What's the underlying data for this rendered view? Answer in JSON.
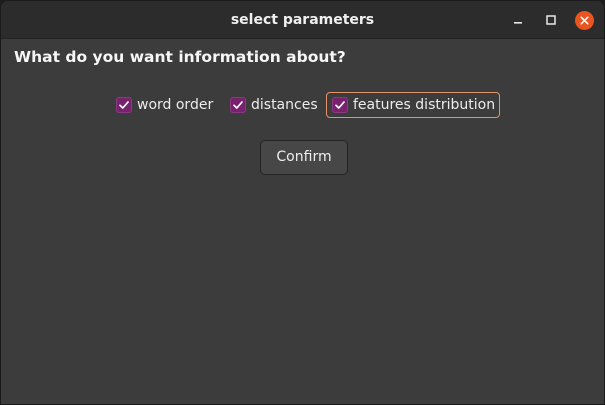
{
  "window": {
    "title": "select parameters"
  },
  "main": {
    "heading": "What do you want information about?",
    "options": [
      {
        "label": "word order",
        "checked": true
      },
      {
        "label": "distances",
        "checked": true
      },
      {
        "label": "features distribution",
        "checked": true,
        "focused": true
      }
    ],
    "confirm_label": "Confirm"
  },
  "colors": {
    "accent": "#77216f",
    "close_button": "#e95420",
    "focus_ring": "#e3926c",
    "window_bg": "#3c3c3c",
    "titlebar_bg": "#2c2c2c"
  },
  "icons": {
    "minimize": "minimize-icon",
    "maximize": "maximize-icon",
    "close": "close-icon",
    "checkmark": "checkmark-icon"
  }
}
